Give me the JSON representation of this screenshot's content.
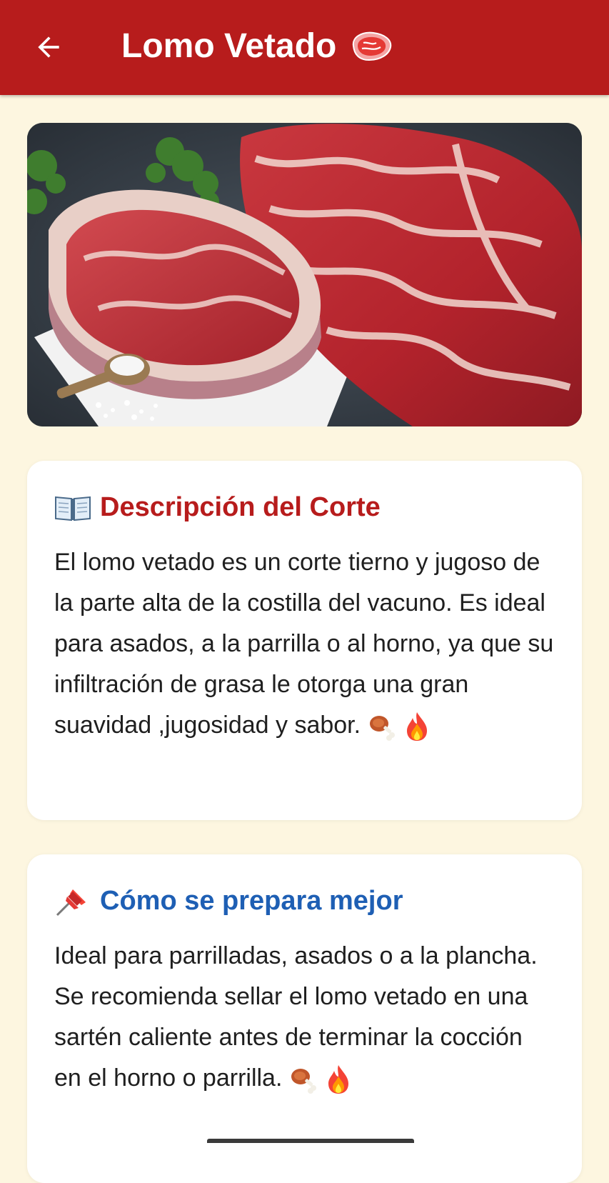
{
  "appbar": {
    "title": "Lomo Vetado",
    "back_icon": "arrow-left-icon",
    "title_icon": "meat-icon",
    "color": "#b71c1c"
  },
  "hero": {
    "icon": "meat-photo"
  },
  "description": {
    "icon": "open-book-icon",
    "title": "Descripción del Corte",
    "body": "El lomo vetado es un corte tierno y jugoso de la parte alta de la costilla del vacuno. Es ideal para asados, a la parrilla o al horno, ya que su infiltración de grasa le otorga una gran suavidad ,jugosidad y sabor.",
    "emojis": [
      "meat-on-bone-icon",
      "fire-icon"
    ],
    "title_color": "#b71c1c"
  },
  "preparation": {
    "icon": "pushpin-icon",
    "title": "Cómo se prepara mejor",
    "body": "Ideal para parrilladas, asados o a la plancha. Se recomienda sellar el lomo vetado en una sartén caliente antes de terminar la cocción en el horno o parrilla.",
    "emojis": [
      "meat-on-bone-icon",
      "fire-icon"
    ],
    "title_color": "#1e5fb4"
  },
  "background_color": "#fdf6e0"
}
